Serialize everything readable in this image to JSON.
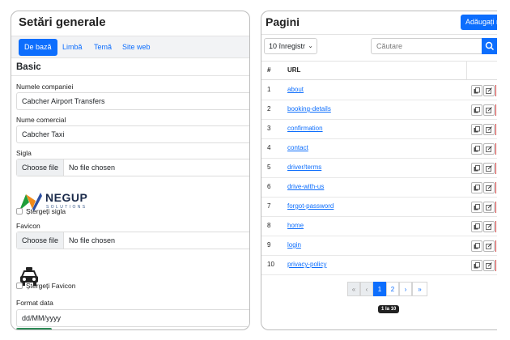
{
  "settings": {
    "title": "Setări generale",
    "tabs": [
      {
        "label": "De bază",
        "active": true
      },
      {
        "label": "Limbă",
        "active": false
      },
      {
        "label": "Temă",
        "active": false
      },
      {
        "label": "Site web",
        "active": false
      }
    ],
    "section_title": "Basic",
    "company_name": {
      "label": "Numele companiei",
      "value": "Cabcher Airport Transfers"
    },
    "commercial_name": {
      "label": "Nume comercial",
      "value": "Cabcher Taxi"
    },
    "logo": {
      "label": "Sigla",
      "choose_label": "Choose file",
      "file_status": "No file chosen",
      "brand_text": "NEGUP",
      "brand_subtext": "SOLUTIONS"
    },
    "delete_logo_label": "Ștergeți sigla",
    "favicon": {
      "label": "Favicon",
      "choose_label": "Choose file",
      "file_status": "No file chosen"
    },
    "delete_favicon_label": "Ștergeți Favicon",
    "date_format": {
      "label": "Format data",
      "value": "dd/MM/yyyy"
    }
  },
  "pages": {
    "title": "Pagini",
    "add_button_label": "Adăugați n",
    "per_page_label": "10 înregistr",
    "search_placeholder": "Căutare",
    "columns": {
      "number": "#",
      "url": "URL"
    },
    "rows": [
      {
        "num": "1",
        "url": "about"
      },
      {
        "num": "2",
        "url": "booking-details"
      },
      {
        "num": "3",
        "url": "confirmation"
      },
      {
        "num": "4",
        "url": "contact"
      },
      {
        "num": "5",
        "url": "driver/terms"
      },
      {
        "num": "6",
        "url": "drive-with-us"
      },
      {
        "num": "7",
        "url": "forgot-password"
      },
      {
        "num": "8",
        "url": "home"
      },
      {
        "num": "9",
        "url": "login"
      },
      {
        "num": "10",
        "url": "privacy-policy"
      }
    ],
    "pagination": {
      "first": "«",
      "prev": "‹",
      "pages": [
        "1",
        "2"
      ],
      "current_page": "1",
      "next": "›",
      "last": "»"
    },
    "range_label": "1 la 10"
  },
  "colors": {
    "primary": "#0d6efd",
    "title_text": "#222222",
    "panel_border": "#bcbcbc"
  },
  "icons": {
    "copy": "copy-icon",
    "edit": "edit-icon",
    "search": "search-icon",
    "dropdown": "chevron-down-icon",
    "favicon": "taxi-icon",
    "logo": "negup-logo"
  }
}
